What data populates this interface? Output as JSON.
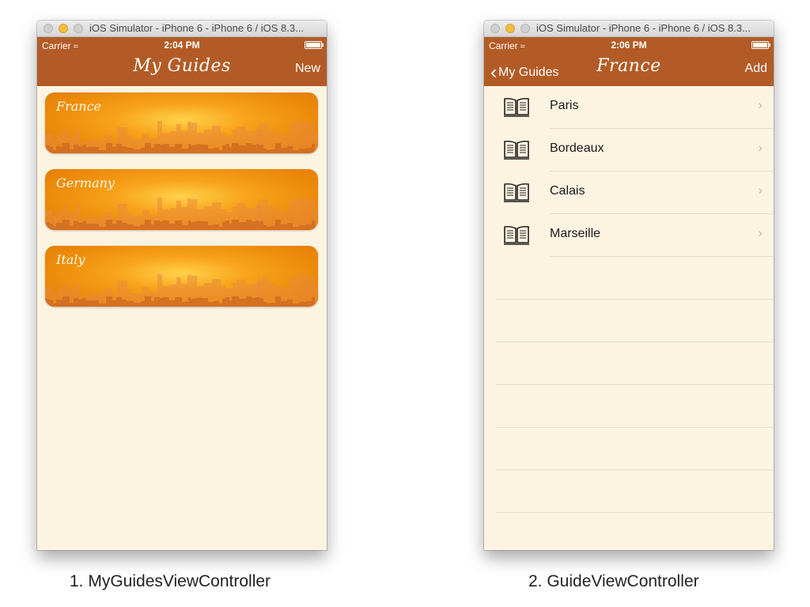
{
  "left_window": {
    "window_title": "iOS Simulator - iPhone 6 - iPhone 6 / iOS 8.3...",
    "status": {
      "carrier": "Carrier",
      "time": "2:04 PM"
    },
    "nav": {
      "title": "My Guides",
      "right_button": "New"
    },
    "guides": [
      {
        "label": "France"
      },
      {
        "label": "Germany"
      },
      {
        "label": "Italy"
      }
    ]
  },
  "right_window": {
    "window_title": "iOS Simulator - iPhone 6 - iPhone 6 / iOS 8.3...",
    "status": {
      "carrier": "Carrier",
      "time": "2:06 PM"
    },
    "nav": {
      "title": "France",
      "back_button": "My Guides",
      "right_button": "Add"
    },
    "cities": [
      {
        "label": "Paris"
      },
      {
        "label": "Bordeaux"
      },
      {
        "label": "Calais"
      },
      {
        "label": "Marseille"
      }
    ]
  },
  "captions": {
    "left": "1. MyGuidesViewController",
    "right": "2. GuideViewController"
  },
  "colors": {
    "nav_bar": "#b35b26",
    "background": "#fdf3e1",
    "card_orange": "#ec8a0a"
  }
}
